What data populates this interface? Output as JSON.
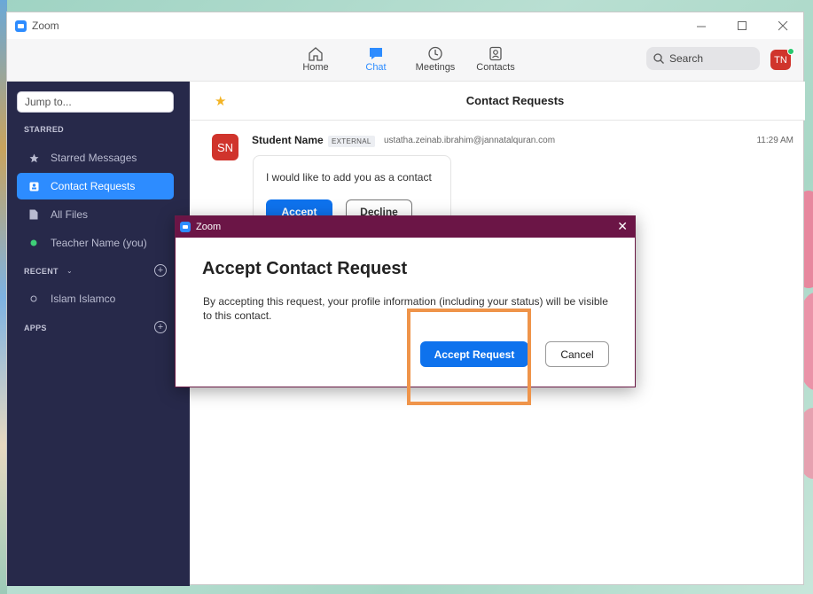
{
  "window": {
    "title": "Zoom"
  },
  "nav": {
    "home": "Home",
    "chat": "Chat",
    "meetings": "Meetings",
    "contacts": "Contacts",
    "search_label": "Search",
    "avatar_initials": "TN",
    "active_color": "#2d8cff"
  },
  "sidebar": {
    "jump_placeholder": "Jump to...",
    "starred_label": "STARRED",
    "items": [
      {
        "label": "Starred Messages",
        "icon": "star-icon"
      },
      {
        "label": "Contact Requests",
        "icon": "contact-card-icon",
        "active": true
      },
      {
        "label": "All Files",
        "icon": "file-icon"
      },
      {
        "label": "Teacher Name (you)",
        "icon": "status-dot-icon"
      }
    ],
    "recent_label": "RECENT",
    "recent_items": [
      {
        "label": "Islam Islamco"
      }
    ],
    "apps_label": "APPS",
    "bg_color": "#27294a"
  },
  "main": {
    "header_title": "Contact Requests",
    "message": {
      "avatar_initials": "SN",
      "name": "Student Name",
      "badge": "EXTERNAL",
      "email": "ustatha.zeinab.ibrahim@jannatalquran.com",
      "time": "11:29 AM",
      "text": "I would like to add you as a contact",
      "accept_label": "Accept",
      "decline_label": "Decline"
    }
  },
  "dialog": {
    "title": "Zoom",
    "heading": "Accept Contact Request",
    "body": "By accepting this request, your profile information (including your status) will be visible to this contact.",
    "accept_label": "Accept Request",
    "cancel_label": "Cancel",
    "titlebar_color": "#6b1546"
  }
}
